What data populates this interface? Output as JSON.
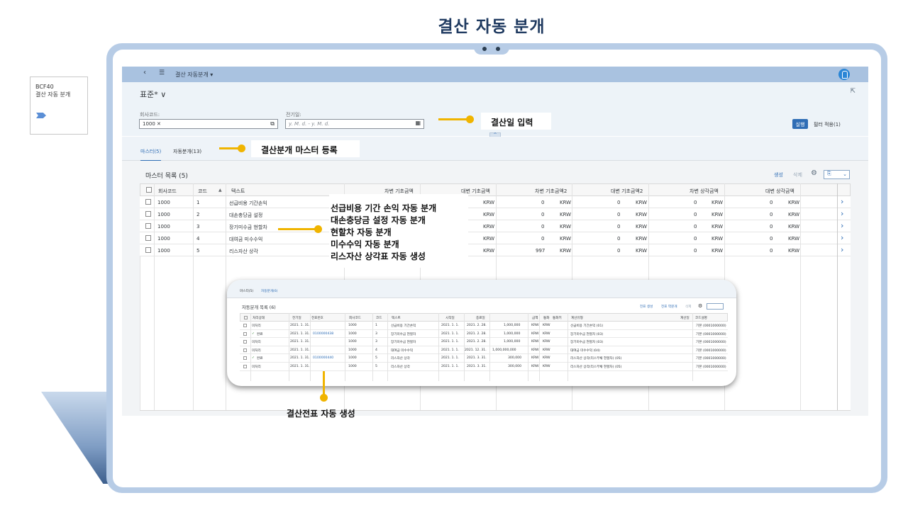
{
  "slide_title": "결산 자동 분개",
  "tcode": {
    "code": "BCF40",
    "name": "결산 자동 분개"
  },
  "shellbar": {
    "title": "결산 자동분개 ▾"
  },
  "header": {
    "variant": "표준* ∨",
    "company_label": "회사코드:",
    "company_token": "1000",
    "date_label": "전기일:",
    "date_placeholder": "y. M. d. - y. M. d.",
    "go_button": "실행",
    "filter_button": "필터 적용(1)"
  },
  "tabs": [
    {
      "label": "마스터(5)"
    },
    {
      "label": "자동분개(13)"
    }
  ],
  "list": {
    "title": "마스터 목록 (5)",
    "create": "생성",
    "delete": "삭제",
    "columns": [
      "회사코드",
      "코드",
      "텍스트",
      "차변 기초금액",
      "대변 기초금액",
      "차변 기초금액2",
      "대변 기초금액2",
      "차변 상각금액",
      "대변 상각금액"
    ],
    "rows": [
      {
        "company": "1000",
        "code": "1",
        "text": "선급비용 기간손익",
        "c4": "KRW",
        "c5v": "0",
        "c5c": "KRW",
        "c6v": "0",
        "c6c": "KRW",
        "c7v": "0",
        "c7c": "KRW",
        "c8v": "0",
        "c8c": "KRW"
      },
      {
        "company": "1000",
        "code": "2",
        "text": "대손충당금 설정",
        "c4": "KRW",
        "c5v": "0",
        "c5c": "KRW",
        "c6v": "0",
        "c6c": "KRW",
        "c7v": "0",
        "c7c": "KRW",
        "c8v": "0",
        "c8c": "KRW"
      },
      {
        "company": "1000",
        "code": "3",
        "text": "장기미수금 현할차",
        "c4": "KRW",
        "c5v": "0",
        "c5c": "KRW",
        "c6v": "0",
        "c6c": "KRW",
        "c7v": "0",
        "c7c": "KRW",
        "c8v": "0",
        "c8c": "KRW"
      },
      {
        "company": "1000",
        "code": "4",
        "text": "대여금 미수수익",
        "c4": "KRW",
        "c5v": "0",
        "c5c": "KRW",
        "c6v": "0",
        "c6c": "KRW",
        "c7v": "0",
        "c7c": "KRW",
        "c8v": "0",
        "c8c": "KRW"
      },
      {
        "company": "1000",
        "code": "5",
        "text": "리스자산 상각",
        "c4": "KRW",
        "c5v": "997",
        "c5c": "KRW",
        "c6v": "0",
        "c6c": "KRW",
        "c7v": "0",
        "c7c": "KRW",
        "c8v": "0",
        "c8c": "KRW"
      }
    ]
  },
  "callouts": {
    "date_input": "결산일 입력",
    "master_reg": "결산분개 마스터 등록",
    "master_list": [
      "선급비용 기간 손익 자동 분개",
      "대손충당금 설정 자동 분개",
      "현할차 자동 분개",
      "미수수익 자동 분개",
      "리스자산 상각표 자동 생성"
    ],
    "auto_doc": "결산전표 자동 생성"
  },
  "popup": {
    "tabs": [
      "마스터(5)",
      "자동분개(6)"
    ],
    "title": "자동분개 목록 (6)",
    "actions": [
      "전표 생성",
      "전표 역분개",
      "삭제"
    ],
    "columns": [
      "처리상태",
      "전기일",
      "전표번호",
      "회사코드",
      "코드",
      "텍스트",
      "시작일",
      "종료일",
      "금액",
      "통화",
      "통화키",
      "계산유형",
      "계산일",
      "코드설명"
    ],
    "rows": [
      {
        "status": "미처리",
        "posted": false,
        "date": "2021. 1. 31.",
        "doc": "",
        "company": "1000",
        "code": "1",
        "text": "선급비용 기간손익",
        "start": "2021. 1. 1.",
        "end": "2021. 2. 28.",
        "amount": "1,000,000",
        "cur": "KRW",
        "cur2": "KRW",
        "calc": "선급비용 기간손익 (01)",
        "desc": "기본 (0001000000)"
      },
      {
        "status": "완료",
        "posted": true,
        "date": "2021. 1. 31.",
        "doc": "0100000438",
        "company": "1000",
        "code": "3",
        "text": "장기미수금 현할차",
        "start": "2021. 1. 1.",
        "end": "2021. 2. 28.",
        "amount": "1,000,000",
        "cur": "KRW",
        "cur2": "KRW",
        "calc": "장기미수금 현할차 (03)",
        "desc": "기본 (0001000000)"
      },
      {
        "status": "미처리",
        "posted": false,
        "date": "2021. 1. 31.",
        "doc": "",
        "company": "1000",
        "code": "3",
        "text": "장기미수금 현할차",
        "start": "2021. 1. 1.",
        "end": "2021. 2. 28.",
        "amount": "1,000,000",
        "cur": "KRW",
        "cur2": "KRW",
        "calc": "장기미수금 현할차 (03)",
        "desc": "기본 (0001000000)"
      },
      {
        "status": "미처리",
        "posted": false,
        "date": "2021. 1. 31.",
        "doc": "",
        "company": "1000",
        "code": "4",
        "text": "대여금 미수수익",
        "start": "2021. 1. 1.",
        "end": "2021. 12. 31.",
        "amount": "1,000,000,000",
        "cur": "KRW",
        "cur2": "KRW",
        "calc": "대여금 미수수익 (04)",
        "desc": "기본 (0001000000)"
      },
      {
        "status": "완료",
        "posted": true,
        "date": "2021. 1. 31.",
        "doc": "0100000440",
        "company": "1000",
        "code": "5",
        "text": "리스자산 상각",
        "start": "2021. 1. 1.",
        "end": "2021. 3. 31.",
        "amount": "300,000",
        "cur": "KRW",
        "cur2": "KRW",
        "calc": "리스자산 상각(리스부채 현할차) (05)",
        "desc": "기본 (0001000000)"
      },
      {
        "status": "미처리",
        "posted": false,
        "date": "2021. 1. 31.",
        "doc": "",
        "company": "1000",
        "code": "5",
        "text": "리스자산 상각",
        "start": "2021. 1. 1.",
        "end": "2021. 3. 31.",
        "amount": "300,000",
        "cur": "KRW",
        "cur2": "KRW",
        "calc": "리스자산 상각(리스부채 현할차) (05)",
        "desc": "기본 (0001000000)"
      }
    ]
  }
}
